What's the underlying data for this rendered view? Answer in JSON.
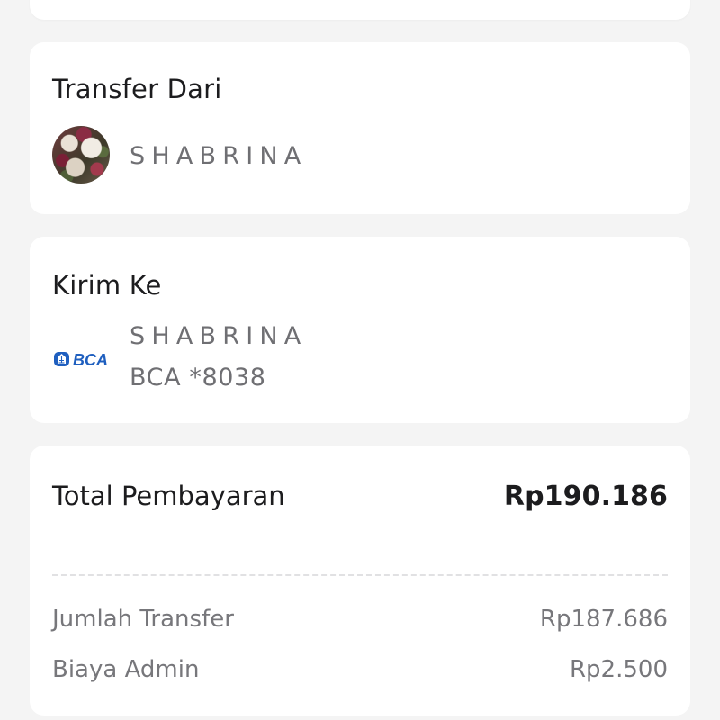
{
  "transfer_from": {
    "title": "Transfer Dari",
    "account_name": "SHABRINA"
  },
  "send_to": {
    "title": "Kirim Ke",
    "recipient_name": "SHABRINA",
    "bank_logo_text": "BCA",
    "bank_account": "BCA *8038"
  },
  "payment": {
    "total_label": "Total Pembayaran",
    "total_amount": "Rp190.186",
    "details": [
      {
        "label": "Jumlah Transfer",
        "value": "Rp187.686"
      },
      {
        "label": "Biaya Admin",
        "value": "Rp2.500"
      }
    ]
  },
  "colors": {
    "background": "#f4f4f4",
    "card": "#ffffff",
    "primary_text": "#1c1c1e",
    "secondary_text": "#6f6f73",
    "bank_blue": "#1f5fbf"
  },
  "icons": {
    "source_avatar": "floral-avatar",
    "bank_logo": "bca-logo"
  }
}
